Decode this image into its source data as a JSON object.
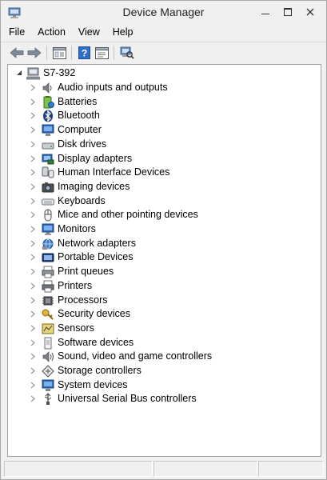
{
  "window": {
    "title": "Device Manager"
  },
  "menu": {
    "items": [
      "File",
      "Action",
      "View",
      "Help"
    ]
  },
  "tree": {
    "root": "S7-392",
    "items": [
      {
        "label": "Audio inputs and outputs",
        "icon": "speaker-icon"
      },
      {
        "label": "Batteries",
        "icon": "battery-icon"
      },
      {
        "label": "Bluetooth",
        "icon": "bluetooth-icon"
      },
      {
        "label": "Computer",
        "icon": "computer-icon"
      },
      {
        "label": "Disk drives",
        "icon": "disk-drive-icon"
      },
      {
        "label": "Display adapters",
        "icon": "display-adapter-icon"
      },
      {
        "label": "Human Interface Devices",
        "icon": "hid-icon"
      },
      {
        "label": "Imaging devices",
        "icon": "camera-icon"
      },
      {
        "label": "Keyboards",
        "icon": "keyboard-icon"
      },
      {
        "label": "Mice and other pointing devices",
        "icon": "mouse-icon"
      },
      {
        "label": "Monitors",
        "icon": "monitor-icon"
      },
      {
        "label": "Network adapters",
        "icon": "network-adapter-icon"
      },
      {
        "label": "Portable Devices",
        "icon": "portable-device-icon"
      },
      {
        "label": "Print queues",
        "icon": "print-queue-icon"
      },
      {
        "label": "Printers",
        "icon": "printer-icon"
      },
      {
        "label": "Processors",
        "icon": "processor-icon"
      },
      {
        "label": "Security devices",
        "icon": "security-key-icon"
      },
      {
        "label": "Sensors",
        "icon": "sensor-icon"
      },
      {
        "label": "Software devices",
        "icon": "software-device-icon"
      },
      {
        "label": "Sound, video and game controllers",
        "icon": "sound-controller-icon"
      },
      {
        "label": "Storage controllers",
        "icon": "storage-controller-icon"
      },
      {
        "label": "System devices",
        "icon": "system-device-icon"
      },
      {
        "label": "Universal Serial Bus controllers",
        "icon": "usb-icon"
      }
    ]
  }
}
